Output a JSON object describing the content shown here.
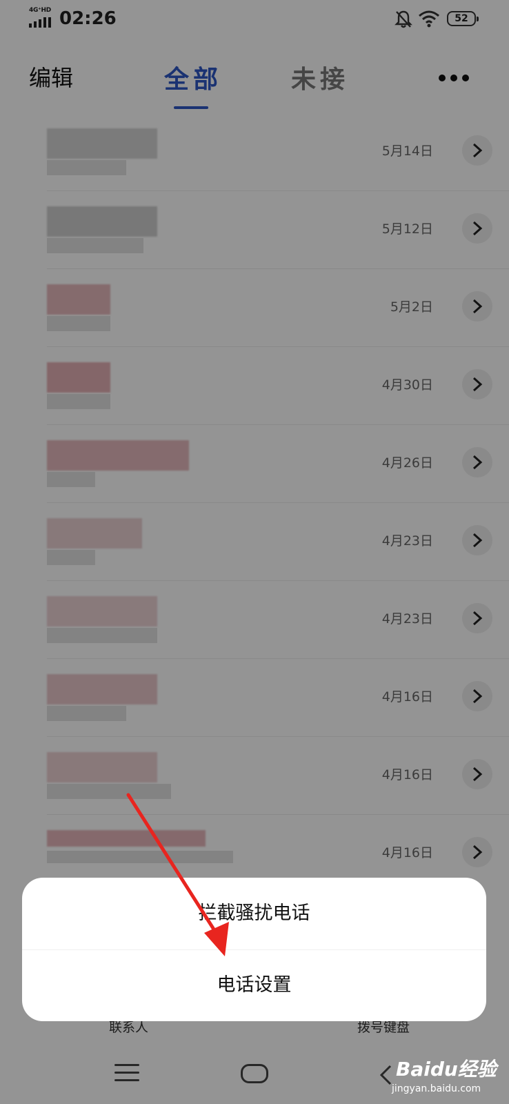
{
  "status_bar": {
    "network": "4G⁺HD",
    "time": "02:26",
    "battery": "52"
  },
  "nav": {
    "edit": "编辑",
    "tab_all": "全部",
    "tab_missed": "未接"
  },
  "calls": [
    {
      "date": "5月14日"
    },
    {
      "date": "5月12日"
    },
    {
      "date": "5月2日"
    },
    {
      "date": "4月30日"
    },
    {
      "date": "4月26日"
    },
    {
      "date": "4月23日"
    },
    {
      "date": "4月23日"
    },
    {
      "date": "4月16日"
    },
    {
      "date": "4月16日"
    },
    {
      "date": "4月16日"
    }
  ],
  "bottom_tabs": {
    "contacts": "联系人",
    "dialpad": "拨号键盘"
  },
  "sheet": {
    "block_spam": "拦截骚扰电话",
    "call_settings": "电话设置"
  },
  "watermark": {
    "brand": "Baidu经验",
    "site": "jingyan.baidu.com"
  },
  "colors": {
    "accent": "#2e56c5",
    "annotation_arrow": "#e8251f"
  }
}
